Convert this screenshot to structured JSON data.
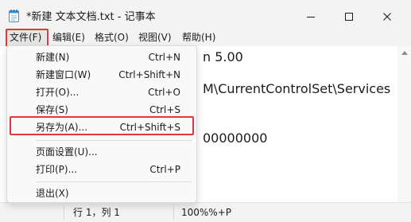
{
  "window": {
    "title": "*新建 文本文档.txt - 记事本"
  },
  "menubar": {
    "items": [
      {
        "label": "文件(F)"
      },
      {
        "label": "编辑(E)"
      },
      {
        "label": "格式(O)"
      },
      {
        "label": "视图(V)"
      },
      {
        "label": "帮助(H)"
      }
    ]
  },
  "editor": {
    "lines": [
      "n 5.00",
      "M\\CurrentControlSet\\Services",
      "00000000"
    ]
  },
  "file_menu": {
    "items": [
      {
        "label": "新建(N)",
        "shortcut": "Ctrl+N"
      },
      {
        "label": "新建窗口(W)",
        "shortcut": "Ctrl+Shift+N"
      },
      {
        "label": "打开(O)...",
        "shortcut": "Ctrl+O"
      },
      {
        "label": "保存(S)",
        "shortcut": "Ctrl+S"
      },
      {
        "label": "另存为(A)...",
        "shortcut": "Ctrl+Shift+S"
      },
      {
        "label": "页面设置(U)...",
        "shortcut": ""
      },
      {
        "label": "打印(P)...",
        "shortcut": "Ctrl+P"
      },
      {
        "label": "退出(X)",
        "shortcut": ""
      }
    ],
    "highlighted": "另存为(A)..."
  },
  "statusbar": {
    "position": "行 1，列 1",
    "zoom": "100%%+P"
  },
  "colors": {
    "highlight_border": "#e0393b",
    "accent": "#3d8fd6"
  },
  "icons": [
    "notepad-icon",
    "minimize-icon",
    "maximize-icon",
    "close-icon",
    "scroll-up-arrow-icon"
  ]
}
